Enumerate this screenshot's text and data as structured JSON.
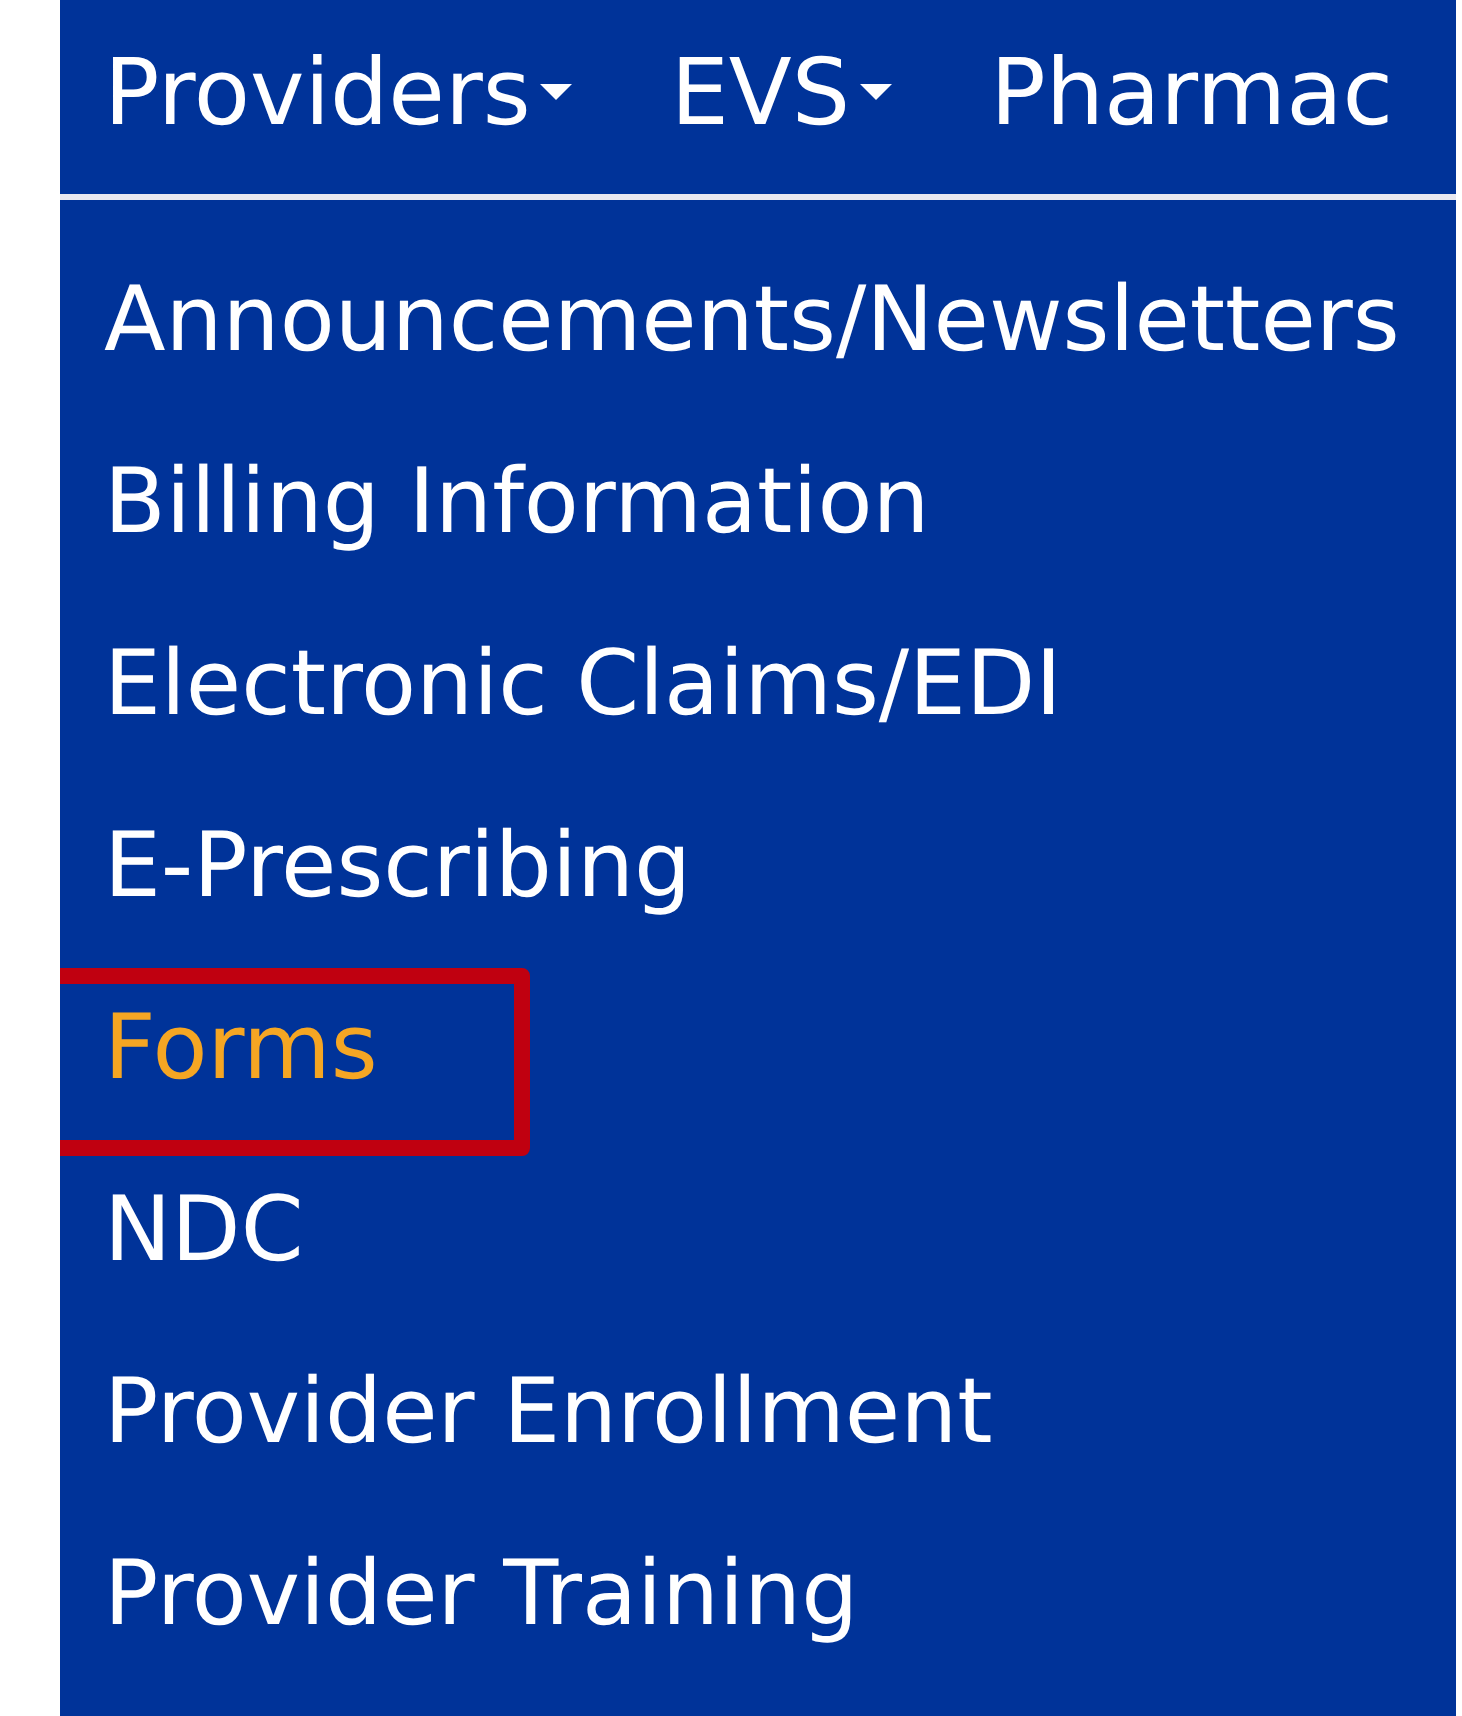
{
  "nav": {
    "items": [
      {
        "label": "Providers",
        "has_caret": true
      },
      {
        "label": "EVS",
        "has_caret": true
      },
      {
        "label": "Pharmac",
        "has_caret": false
      }
    ]
  },
  "menu": {
    "items": [
      {
        "label": "Announcements/Newsletters",
        "selected": false
      },
      {
        "label": "Billing Information",
        "selected": false
      },
      {
        "label": "Electronic Claims/EDI",
        "selected": false
      },
      {
        "label": "E-Prescribing",
        "selected": false
      },
      {
        "label": "Forms",
        "selected": true
      },
      {
        "label": "NDC",
        "selected": false
      },
      {
        "label": "Provider Enrollment",
        "selected": false
      },
      {
        "label": "Provider Training",
        "selected": false
      }
    ]
  }
}
